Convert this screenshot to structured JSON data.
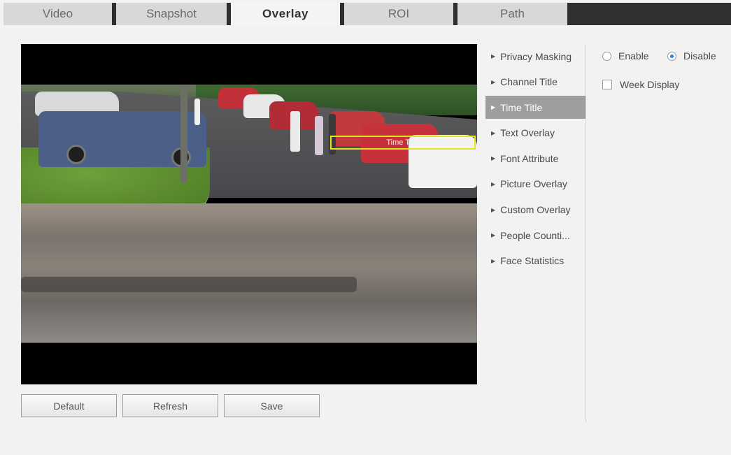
{
  "tabs": [
    {
      "label": "Video",
      "active": false
    },
    {
      "label": "Snapshot",
      "active": false
    },
    {
      "label": "Overlay",
      "active": true
    },
    {
      "label": "ROI",
      "active": false
    },
    {
      "label": "Path",
      "active": false
    }
  ],
  "video": {
    "overlay_label": "Time Title"
  },
  "buttons": {
    "default": "Default",
    "refresh": "Refresh",
    "save": "Save"
  },
  "menu": [
    {
      "label": "Privacy Masking",
      "active": false
    },
    {
      "label": "Channel Title",
      "active": false
    },
    {
      "label": "Time Title",
      "active": true
    },
    {
      "label": "Text Overlay",
      "active": false
    },
    {
      "label": "Font Attribute",
      "active": false
    },
    {
      "label": "Picture Overlay",
      "active": false
    },
    {
      "label": "Custom Overlay",
      "active": false
    },
    {
      "label": "People Counti...",
      "active": false
    },
    {
      "label": "Face Statistics",
      "active": false
    }
  ],
  "options": {
    "enable_label": "Enable",
    "disable_label": "Disable",
    "selected": "Disable",
    "week_display_label": "Week Display",
    "week_display_checked": false
  },
  "colors": {
    "active_menu_bg": "#9e9e9e",
    "overlay_box": "#e3e61f",
    "tab_separator": "#2e2e2e"
  }
}
